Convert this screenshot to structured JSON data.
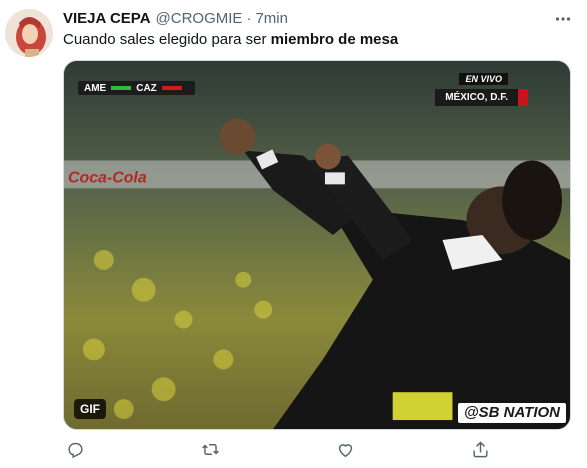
{
  "tweet": {
    "author_name": "VIEJA CEPA",
    "handle": "@CROGMIE",
    "separator": "·",
    "time": "7min",
    "text_plain": "Cuando sales elegido para ser ",
    "text_bold": "miembro de mesa"
  },
  "media": {
    "type": "gif",
    "gif_badge": "GIF",
    "watermark": "@SB NATION",
    "scoreboard": {
      "team_home": "AME",
      "team_away": "CAZ",
      "home_color": "#2dbd3a",
      "away_color": "#d21c1c"
    },
    "live_label": "EN VIVO",
    "location": "MÉXICO, D.F.",
    "banner_text": "Coca-Cola"
  },
  "actions": {
    "reply": "reply-icon",
    "retweet": "retweet-icon",
    "like": "heart-icon",
    "share": "share-icon"
  },
  "colors": {
    "text_primary": "#0f1419",
    "text_secondary": "#536471",
    "border": "#cfd9de"
  }
}
